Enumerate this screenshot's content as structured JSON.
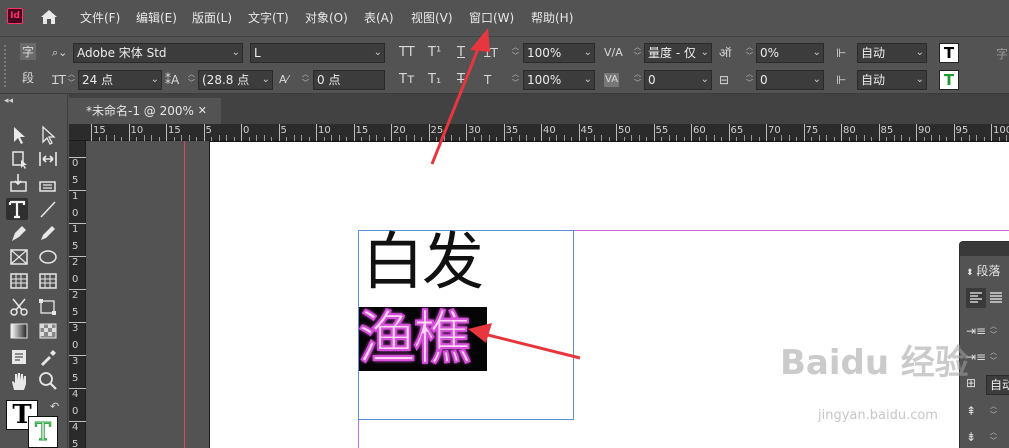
{
  "menu": {
    "logo": "Id",
    "items": [
      "文件(F)",
      "编辑(E)",
      "版面(L)",
      "文字(T)",
      "对象(O)",
      "表(A)",
      "视图(V)",
      "窗口(W)",
      "帮助(H)"
    ]
  },
  "control": {
    "char_label": "字",
    "para_label": "段",
    "font_family": "Adobe 宋体 Std",
    "font_style": "L",
    "font_size": "24 点",
    "leading": "(28.8 点",
    "kerning_val": "0 点",
    "tt_caps": "TT",
    "tt_super": "T¹",
    "tt_under": "T",
    "tt_small": "Tт",
    "tt_sub": "T₁",
    "tt_strike": "T",
    "vscale": "100%",
    "hscale": "100%",
    "kerning_mode": "量度 - 仅",
    "tracking": "0",
    "baseline": "0%",
    "skew": "0",
    "auto1": "自动",
    "auto2": "自动",
    "right_char": "字"
  },
  "document": {
    "tab_title": "*未命名-1 @ 200%",
    "tab_close": "✕",
    "hruler": [
      "15",
      "10",
      "15",
      "5",
      "0",
      "5",
      "10",
      "15",
      "20",
      "25",
      "30",
      "35",
      "40",
      "45",
      "50",
      "55",
      "60",
      "65",
      "70",
      "75",
      "80",
      "85",
      "90",
      "95",
      "100",
      "105",
      "110",
      "115",
      "120",
      "125"
    ],
    "vruler": [
      "0",
      "5",
      "1",
      "0",
      "1",
      "5",
      "2",
      "0",
      "2",
      "5",
      "3",
      "0",
      "3",
      "5",
      "4",
      "0",
      "4",
      "5"
    ],
    "text1": "白发",
    "text2": "渔樵"
  },
  "panel": {
    "title": "段落",
    "auto": "自动"
  },
  "watermark": {
    "brand": "Baidu 经验",
    "url": "jingyan.baidu.com"
  },
  "colors": {
    "ui_bg": "#535353",
    "accent_arrow": "#e8363e",
    "glow": "#d74fdc",
    "frame": "#5b8fd6",
    "margin": "#c66cd9"
  }
}
